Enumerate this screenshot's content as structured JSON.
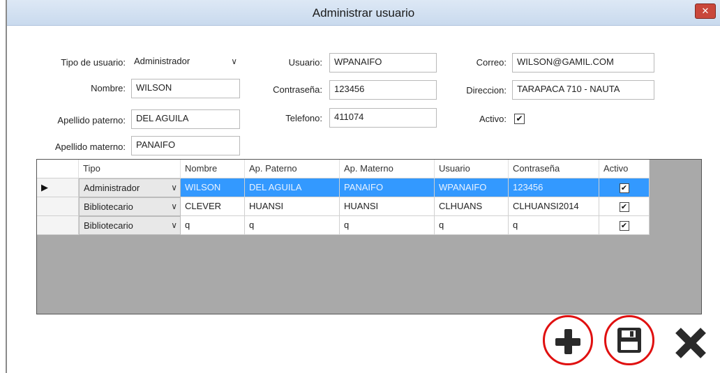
{
  "window": {
    "title": "Administrar usuario",
    "close_label": "✕"
  },
  "form": {
    "tipo_label": "Tipo de usuario:",
    "tipo_value": "Administrador",
    "nombre_label": "Nombre:",
    "nombre_value": "WILSON",
    "apaterno_label": "Apellido paterno:",
    "apaterno_value": "DEL AGUILA",
    "amaterno_label": "Apellido materno:",
    "amaterno_value": "PANAIFO",
    "usuario_label": "Usuario:",
    "usuario_value": "WPANAIFO",
    "contrasena_label": "Contraseña:",
    "contrasena_value": "123456",
    "telefono_label": "Telefono:",
    "telefono_value": "411074",
    "correo_label": "Correo:",
    "correo_value": "WILSON@GAMIL.COM",
    "direccion_label": "Direccion:",
    "direccion_value": "TARAPACA 710 - NAUTA",
    "activo_label": "Activo:",
    "activo_checked": "✔"
  },
  "grid": {
    "headers": [
      "Tipo",
      "Nombre",
      "Ap. Paterno",
      "Ap. Materno",
      "Usuario",
      "Contraseña",
      "Activo"
    ],
    "rows": [
      {
        "marker": "▶",
        "tipo": "Administrador",
        "nombre": "WILSON",
        "apaterno": "DEL AGUILA",
        "amaterno": "PANAIFO",
        "usuario": "WPANAIFO",
        "contrasena": "123456",
        "activo": "✔"
      },
      {
        "marker": "",
        "tipo": "Bibliotecario",
        "nombre": "CLEVER",
        "apaterno": "HUANSI",
        "amaterno": "HUANSI",
        "usuario": "CLHUANS",
        "contrasena": "CLHUANSI2014",
        "activo": "✔"
      },
      {
        "marker": "",
        "tipo": "Bibliotecario",
        "nombre": "q",
        "apaterno": "q",
        "amaterno": "q",
        "usuario": "q",
        "contrasena": "q",
        "activo": "✔"
      }
    ]
  },
  "actions": {
    "add_icon": "plus-icon",
    "save_icon": "floppy-disk-icon",
    "cancel_icon": "close-x-icon"
  },
  "colors": {
    "selection": "#3399ff",
    "highlight_circle": "#e01010",
    "grid_background": "#a9a9a9"
  }
}
